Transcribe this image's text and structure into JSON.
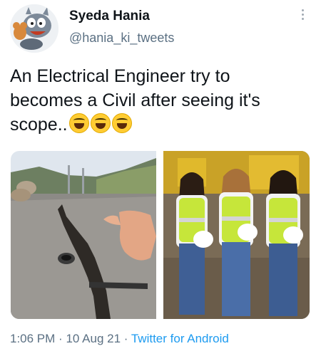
{
  "author": {
    "display_name": "Syeda Hania",
    "handle": "@hania_ki_tweets",
    "avatar_icon": "cartoon-cat-and-mouse-avatar"
  },
  "tweet": {
    "text_line1": "An Electrical Engineer try to",
    "text_line2": "becomes a Civil after seeing it's",
    "text_line3": "scope..",
    "emojis": [
      "grinning-sweat-emoji",
      "laughing-squinting-emoji",
      "tears-of-joy-emoji"
    ]
  },
  "media": [
    {
      "name": "photo-cracked-road",
      "kind": "photo"
    },
    {
      "name": "photo-engineers-in-vests",
      "kind": "photo"
    }
  ],
  "meta": {
    "time": "1:06 PM",
    "separator": "·",
    "date": "10 Aug 21",
    "source": "Twitter for Android"
  },
  "colors": {
    "text": "#0f1419",
    "secondary": "#5b7083",
    "link": "#1d9bf0"
  }
}
